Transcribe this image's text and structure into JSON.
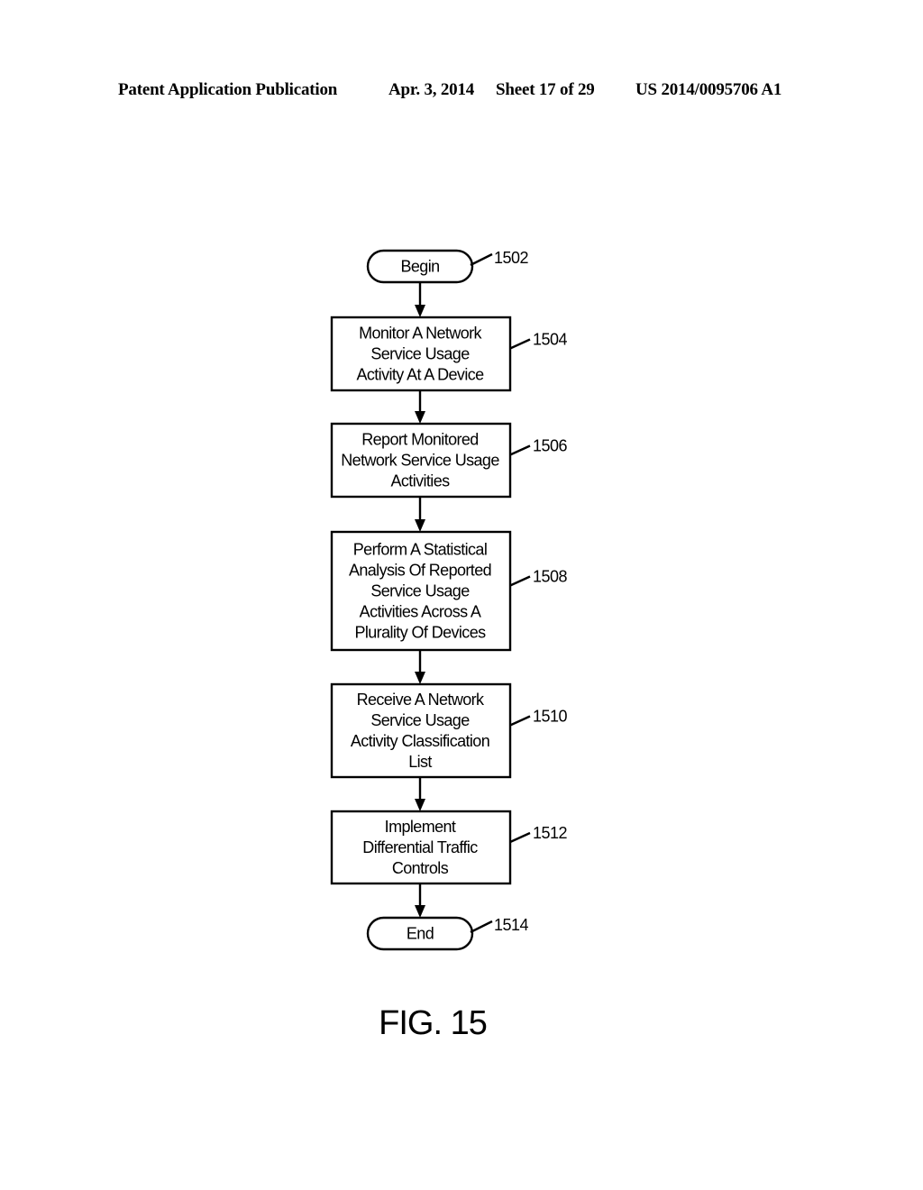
{
  "header": {
    "publication": "Patent Application Publication",
    "date": "Apr. 3, 2014",
    "sheet": "Sheet 17 of 29",
    "number": "US 2014/0095706 A1"
  },
  "flowchart": {
    "nodes": [
      {
        "id": "1502",
        "type": "terminal",
        "lines": [
          "Begin"
        ],
        "ref": "1502"
      },
      {
        "id": "1504",
        "type": "process",
        "lines": [
          "Monitor A Network",
          "Service Usage",
          "Activity At A Device"
        ],
        "ref": "1504"
      },
      {
        "id": "1506",
        "type": "process",
        "lines": [
          "Report Monitored",
          "Network Service Usage",
          "Activities"
        ],
        "ref": "1506"
      },
      {
        "id": "1508",
        "type": "process",
        "lines": [
          "Perform A Statistical",
          "Analysis Of Reported",
          "Service Usage",
          "Activities Across A",
          "Plurality Of Devices"
        ],
        "ref": "1508"
      },
      {
        "id": "1510",
        "type": "process",
        "lines": [
          "Receive A Network",
          "Service Usage",
          "Activity Classification",
          "List"
        ],
        "ref": "1510"
      },
      {
        "id": "1512",
        "type": "process",
        "lines": [
          "Implement",
          "Differential Traffic",
          "Controls"
        ],
        "ref": "1512"
      },
      {
        "id": "1514",
        "type": "terminal",
        "lines": [
          "End"
        ],
        "ref": "1514"
      }
    ],
    "edges": [
      [
        "1502",
        "1504"
      ],
      [
        "1504",
        "1506"
      ],
      [
        "1506",
        "1508"
      ],
      [
        "1508",
        "1510"
      ],
      [
        "1510",
        "1512"
      ],
      [
        "1512",
        "1514"
      ]
    ]
  },
  "figure_label": "FIG. 15"
}
